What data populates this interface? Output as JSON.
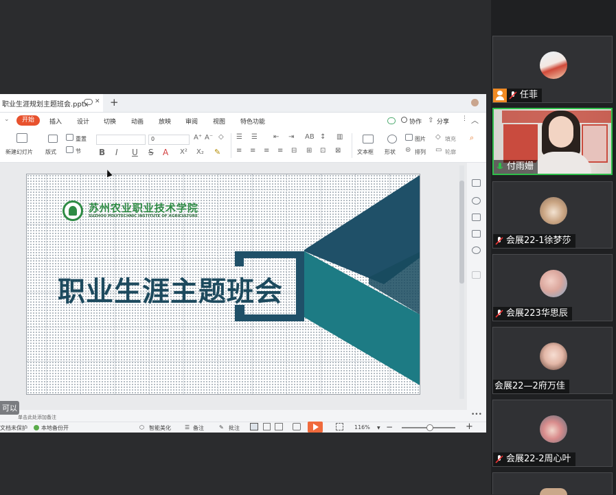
{
  "window": {
    "doc_tab_title": "职业生涯规划主题班会.pptx",
    "close_glyph": "✕",
    "add_tab_glyph": "+"
  },
  "menu": {
    "items": [
      "开始",
      "插入",
      "设计",
      "切换",
      "动画",
      "放映",
      "审阅",
      "视图",
      "特色功能"
    ],
    "collab": "协作",
    "share": "分享"
  },
  "ribbon": {
    "new_slide": "新建幻灯片",
    "layout": "版式",
    "reset": "重置",
    "section": "节",
    "font_size": "0",
    "bold": "B",
    "italic": "I",
    "underline": "U",
    "strike": "S",
    "font_color": "A",
    "superscript": "X²",
    "subscript": "X₂",
    "textbox": "文本框",
    "shape": "形状",
    "arrange": "排列",
    "picture": "图片",
    "fill": "填充",
    "outline": "轮廓"
  },
  "slide": {
    "school_cn": "苏州农业职业技术学院",
    "school_en": "SUZHOU POLYTECHNIC INSTITUTE OF AGRICULTURE",
    "title": "职业生涯主题班会",
    "colors": {
      "dark": "#1f5068",
      "teal": "#1d7b84",
      "title": "#1d4a5e"
    }
  },
  "statusbar": {
    "notes_hint": "单击此处添加备注",
    "protect": "文档未保护",
    "backup": "本地备份开",
    "beautify": "智能美化",
    "notes": "备注",
    "comment": "批注",
    "zoom": "116%",
    "more": "•••"
  },
  "floating_label": "可以",
  "participants": [
    {
      "name": "任菲",
      "avatar": "child-photo",
      "host": true,
      "active": false
    },
    {
      "name": "付雨姗",
      "avatar": "video-feed",
      "host": false,
      "active": true
    },
    {
      "name": "会展22-1徐梦莎",
      "avatar": "dog-photo",
      "host": false,
      "active": false
    },
    {
      "name": "会展223华思辰",
      "avatar": "cartoon-photo",
      "host": false,
      "active": false
    },
    {
      "name": "会展22—2府万佳",
      "avatar": "girl-photo",
      "host": false,
      "active": false
    },
    {
      "name": "会展22-2周心叶",
      "avatar": "girl-hat-photo",
      "host": false,
      "active": false
    }
  ]
}
